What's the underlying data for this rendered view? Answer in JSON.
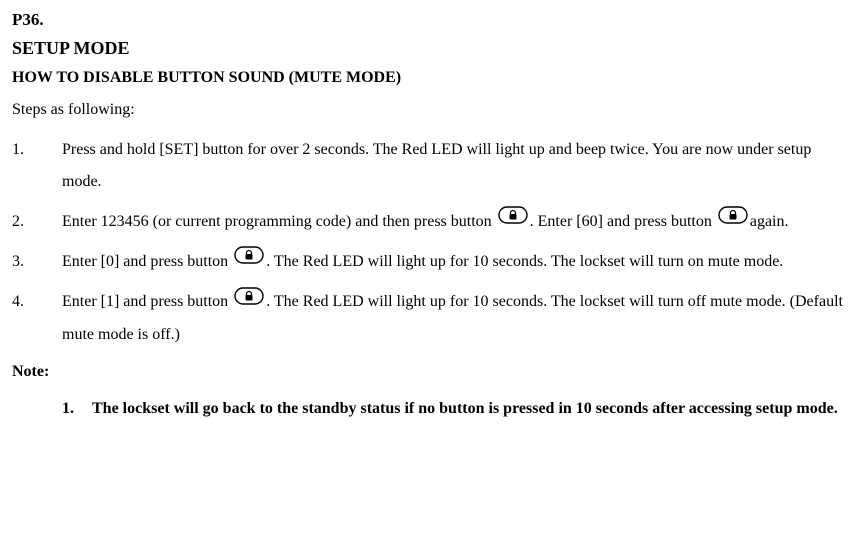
{
  "page_number": "P36.",
  "title": "SETUP MODE",
  "subtitle": "HOW TO DISABLE BUTTON SOUND (MUTE MODE)",
  "intro": "Steps as following:",
  "steps": [
    {
      "num": "1.",
      "parts": [
        "Press and hold [SET] button for over 2 seconds. The Red LED will light up and beep twice. You are now under setup mode."
      ]
    },
    {
      "num": "2.",
      "parts": [
        "Enter 123456 (or current programming code) and then press button ",
        "ICON",
        ". Enter [60] and press button   ",
        "ICON",
        "again."
      ]
    },
    {
      "num": "3.",
      "parts": [
        "Enter [0] and press button ",
        "ICON",
        ". The Red LED will light up for 10 seconds. The lockset will turn on mute mode."
      ]
    },
    {
      "num": "4.",
      "parts": [
        "Enter [1] and press button ",
        "ICON",
        ". The Red LED will light up for 10 seconds. The lockset will turn off mute mode. (Default mute mode is off.)"
      ]
    }
  ],
  "note_label": "Note:",
  "notes": [
    {
      "num": "1.",
      "text": "The lockset will go back to the standby status if no button is pressed in 10 seconds after accessing setup mode."
    }
  ]
}
